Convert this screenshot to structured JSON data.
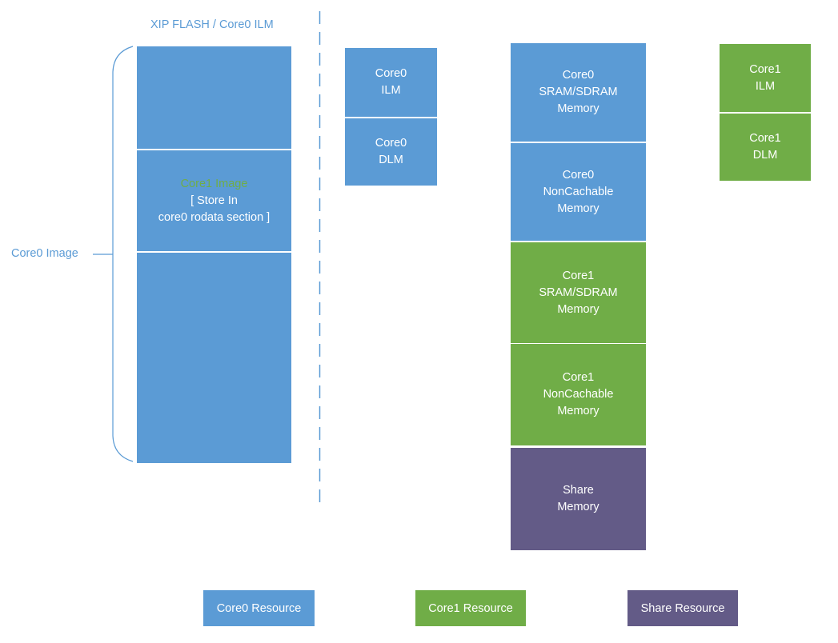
{
  "colors": {
    "core0": "#5b9bd5",
    "core1": "#70ad47",
    "share": "#635b87",
    "label_text": "#5b9bd5",
    "core1_image_text": "#70ad47"
  },
  "flash": {
    "title": "XIP FLASH / Core0 ILM",
    "brace_label": "Core0 Image",
    "segments": [
      {
        "lines": []
      },
      {
        "highlight": "Core1 Image",
        "lines": [
          "[ Store In",
          "core0 rodata section ]"
        ]
      },
      {
        "lines": []
      }
    ]
  },
  "core0_lm": [
    {
      "lines": [
        "Core0",
        "ILM"
      ]
    },
    {
      "lines": [
        "Core0",
        "DLM"
      ]
    }
  ],
  "memory_stack": [
    {
      "owner": "core0",
      "lines": [
        "Core0",
        "SRAM/SDRAM",
        "Memory"
      ]
    },
    {
      "owner": "core0",
      "lines": [
        "Core0",
        "NonCachable",
        "Memory"
      ]
    },
    {
      "owner": "core1",
      "lines": [
        "Core1",
        "SRAM/SDRAM",
        "Memory"
      ]
    },
    {
      "owner": "core1",
      "lines": [
        "Core1",
        "NonCachable",
        "Memory"
      ]
    },
    {
      "owner": "share",
      "lines": [
        "Share",
        "Memory"
      ]
    }
  ],
  "core1_lm": [
    {
      "lines": [
        "Core1",
        "ILM"
      ]
    },
    {
      "lines": [
        "Core1",
        "DLM"
      ]
    }
  ],
  "legend": [
    {
      "owner": "core0",
      "label": "Core0 Resource"
    },
    {
      "owner": "core1",
      "label": "Core1 Resource"
    },
    {
      "owner": "share",
      "label": "Share Resource"
    }
  ]
}
